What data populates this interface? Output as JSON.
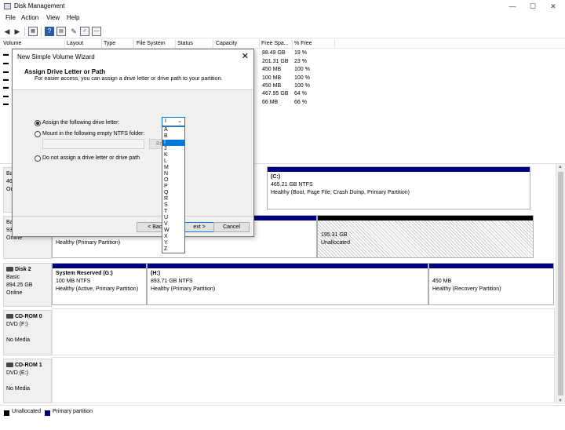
{
  "window": {
    "title": "Disk Management",
    "controls": [
      "—",
      "☐",
      "✕"
    ]
  },
  "menu": [
    "File",
    "Action",
    "View",
    "Help"
  ],
  "columns": [
    "Volume",
    "Layout",
    "Type",
    "File System",
    "Status",
    "Capacity",
    "Free Spa...",
    "% Free"
  ],
  "volumes": [
    {
      "free": "88.49 GB",
      "pct": "19 %"
    },
    {
      "free": "201.31 GB",
      "pct": "23 %"
    },
    {
      "free": "450 MB",
      "pct": "100 %"
    },
    {
      "free": "100 MB",
      "pct": "100 %"
    },
    {
      "free": "450 MB",
      "pct": "100 %"
    },
    {
      "free": "467.95 GB",
      "pct": "64 %"
    },
    {
      "free": "66 MB",
      "pct": "66 %"
    }
  ],
  "disks": {
    "disk0": {
      "label_parts": [
        "Ba",
        "46",
        "On"
      ],
      "c_partition": {
        "name": "(C:)",
        "size": "465.21 GB NTFS",
        "status": "Healthy (Boot, Page File, Crash Dump, Primary Partition)"
      }
    },
    "disk1": {
      "label_parts": [
        "Ba",
        "93",
        "Online"
      ],
      "primary": {
        "status": "Healthy (Primary Partition)"
      },
      "unallocated": {
        "size": "195.31 GB",
        "status": "Unallocated"
      }
    },
    "disk2": {
      "name": "Disk 2",
      "type": "Basic",
      "size": "894.25 GB",
      "status": "Online",
      "partitions": [
        {
          "name": "System Reserved  (G:)",
          "size": "100 MB NTFS",
          "status": "Healthy (Active, Primary Partition)"
        },
        {
          "name": "(H:)",
          "size": "893.71 GB NTFS",
          "status": "Healthy (Primary Partition)"
        },
        {
          "name": "",
          "size": "450 MB",
          "status": "Healthy (Recovery Partition)"
        }
      ]
    },
    "cdrom0": {
      "name": "CD-ROM 0",
      "drive": "DVD (F:)",
      "media": "No Media"
    },
    "cdrom1": {
      "name": "CD-ROM 1",
      "drive": "DVD (E:)",
      "media": "No Media"
    }
  },
  "legend": [
    {
      "label": "Unallocated",
      "color": "#000000"
    },
    {
      "label": "Primary partition",
      "color": "#00007e"
    }
  ],
  "wizard": {
    "title": "New Simple Volume Wizard",
    "heading": "Assign Drive Letter or Path",
    "subheading": "For easier access, you can assign a drive letter or drive path to your partition.",
    "option_assign": "Assign the following drive letter:",
    "option_mount": "Mount in the following empty NTFS folder:",
    "option_none": "Do not assign a drive letter or drive path",
    "browse_label": "Br",
    "back_label": "< Back",
    "next_label": "ext >",
    "cancel_label": "Cancel",
    "selected_letter": "I",
    "letters": [
      "A",
      "B",
      "I",
      "J",
      "K",
      "L",
      "M",
      "N",
      "O",
      "P",
      "Q",
      "R",
      "S",
      "T",
      "U",
      "V",
      "W",
      "X",
      "Y",
      "Z"
    ],
    "highlighted_letter": "I"
  }
}
